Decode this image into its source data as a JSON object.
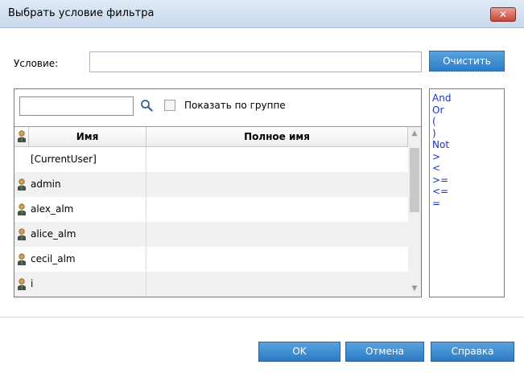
{
  "window": {
    "title": "Выбрать условие фильтра",
    "close_label": "✕"
  },
  "condition": {
    "label": "Условие:",
    "value": "",
    "clear_label": "Очистить"
  },
  "user_panel": {
    "search_value": "",
    "group_label": "Показать по группе",
    "group_checked": false,
    "columns": [
      "Имя",
      "Полное имя"
    ],
    "rows": [
      {
        "name": "[CurrentUser]",
        "full_name": "",
        "has_icon": false
      },
      {
        "name": "admin",
        "full_name": "",
        "has_icon": true
      },
      {
        "name": "alex_alm",
        "full_name": "",
        "has_icon": true
      },
      {
        "name": "alice_alm",
        "full_name": "",
        "has_icon": true
      },
      {
        "name": "cecil_alm",
        "full_name": "",
        "has_icon": true
      },
      {
        "name": "i",
        "full_name": "",
        "has_icon": true
      }
    ]
  },
  "operators": [
    "And",
    "Or",
    "(",
    ")",
    "Not",
    ">",
    "<",
    ">=",
    "<=",
    "="
  ],
  "footer": {
    "ok_label": "OK",
    "cancel_label": "Отмена",
    "help_label": "Справка"
  },
  "colors": {
    "accent": "#2b7bc4",
    "operator_text": "#1b32c9",
    "close": "#c8453a"
  }
}
